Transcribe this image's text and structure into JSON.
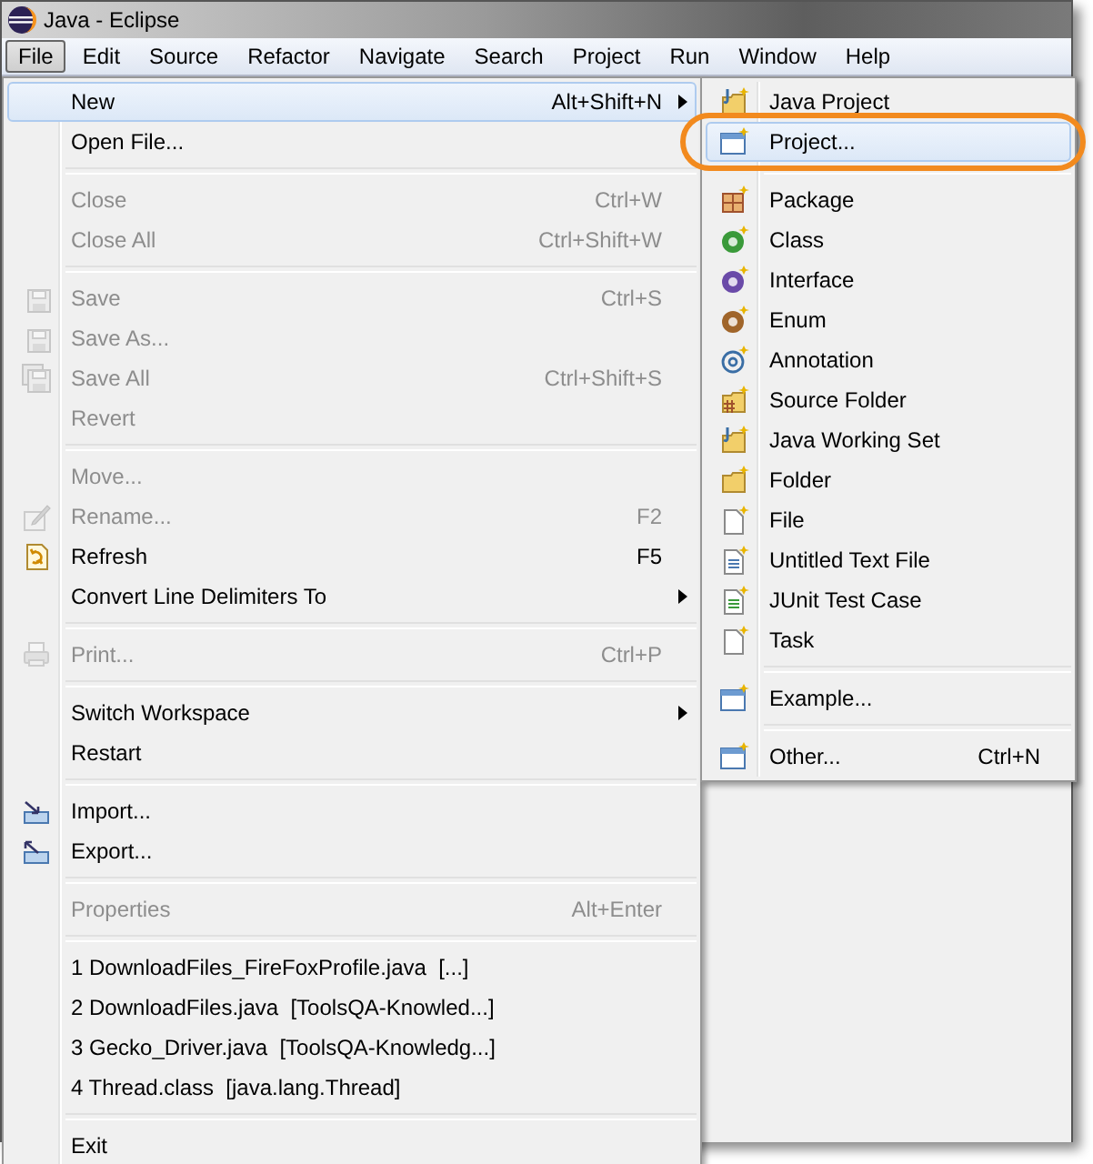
{
  "window": {
    "title": "Java - Eclipse"
  },
  "menu_bar": [
    {
      "label": "File",
      "selected": true
    },
    {
      "label": "Edit",
      "selected": false
    },
    {
      "label": "Source",
      "selected": false
    },
    {
      "label": "Refactor",
      "selected": false
    },
    {
      "label": "Navigate",
      "selected": false
    },
    {
      "label": "Search",
      "selected": false
    },
    {
      "label": "Project",
      "selected": false
    },
    {
      "label": "Run",
      "selected": false
    },
    {
      "label": "Window",
      "selected": false
    },
    {
      "label": "Help",
      "selected": false
    }
  ],
  "file_menu": [
    {
      "kind": "command",
      "label": "New",
      "shortcut": "Alt+Shift+N",
      "submenu": true,
      "disabled": false,
      "selected": true
    },
    {
      "kind": "command",
      "label": "Open File...",
      "submenu": false,
      "disabled": false,
      "selected": false
    },
    {
      "kind": "separator"
    },
    {
      "kind": "command",
      "label": "Close",
      "shortcut": "Ctrl+W",
      "submenu": false,
      "disabled": true,
      "selected": false
    },
    {
      "kind": "command",
      "label": "Close All",
      "shortcut": "Ctrl+Shift+W",
      "submenu": false,
      "disabled": true,
      "selected": false
    },
    {
      "kind": "separator"
    },
    {
      "kind": "command",
      "label": "Save",
      "shortcut": "Ctrl+S",
      "submenu": false,
      "disabled": true,
      "selected": false
    },
    {
      "kind": "command",
      "label": "Save As...",
      "submenu": false,
      "disabled": true,
      "selected": false
    },
    {
      "kind": "command",
      "label": "Save All",
      "shortcut": "Ctrl+Shift+S",
      "submenu": false,
      "disabled": true,
      "selected": false
    },
    {
      "kind": "command",
      "label": "Revert",
      "submenu": false,
      "disabled": true,
      "selected": false
    },
    {
      "kind": "separator"
    },
    {
      "kind": "command",
      "label": "Move...",
      "submenu": false,
      "disabled": true,
      "selected": false
    },
    {
      "kind": "command",
      "label": "Rename...",
      "shortcut": "F2",
      "submenu": false,
      "disabled": true,
      "selected": false
    },
    {
      "kind": "command",
      "label": "Refresh",
      "shortcut": "F5",
      "submenu": false,
      "disabled": false,
      "selected": false
    },
    {
      "kind": "command",
      "label": "Convert Line Delimiters To",
      "submenu": true,
      "disabled": false,
      "selected": false
    },
    {
      "kind": "separator"
    },
    {
      "kind": "command",
      "label": "Print...",
      "shortcut": "Ctrl+P",
      "submenu": false,
      "disabled": true,
      "selected": false
    },
    {
      "kind": "separator"
    },
    {
      "kind": "command",
      "label": "Switch Workspace",
      "submenu": true,
      "disabled": false,
      "selected": false
    },
    {
      "kind": "command",
      "label": "Restart",
      "submenu": false,
      "disabled": false,
      "selected": false
    },
    {
      "kind": "separator"
    },
    {
      "kind": "command",
      "label": "Import...",
      "submenu": false,
      "disabled": false,
      "selected": false
    },
    {
      "kind": "command",
      "label": "Export...",
      "submenu": false,
      "disabled": false,
      "selected": false
    },
    {
      "kind": "separator"
    },
    {
      "kind": "command",
      "label": "Properties",
      "shortcut": "Alt+Enter",
      "submenu": false,
      "disabled": true,
      "selected": false
    },
    {
      "kind": "separator"
    },
    {
      "kind": "command",
      "label": "1 DownloadFiles_FireFoxProfile.java  [...]",
      "submenu": false,
      "disabled": false,
      "selected": false
    },
    {
      "kind": "command",
      "label": "2 DownloadFiles.java  [ToolsQA-Knowled...]",
      "submenu": false,
      "disabled": false,
      "selected": false
    },
    {
      "kind": "command",
      "label": "3 Gecko_Driver.java  [ToolsQA-Knowledg...]",
      "submenu": false,
      "disabled": false,
      "selected": false
    },
    {
      "kind": "command",
      "label": "4 Thread.class  [java.lang.Thread]",
      "submenu": false,
      "disabled": false,
      "selected": false
    },
    {
      "kind": "separator"
    },
    {
      "kind": "command",
      "label": "Exit",
      "submenu": false,
      "disabled": false,
      "selected": false
    }
  ],
  "new_submenu": [
    {
      "kind": "command",
      "label": "Java Project",
      "selected": false,
      "circled": false
    },
    {
      "kind": "command",
      "label": "Project...",
      "selected": true,
      "circled": true
    },
    {
      "kind": "separator"
    },
    {
      "kind": "command",
      "label": "Package",
      "selected": false,
      "circled": false
    },
    {
      "kind": "command",
      "label": "Class",
      "selected": false,
      "circled": false
    },
    {
      "kind": "command",
      "label": "Interface",
      "selected": false,
      "circled": false
    },
    {
      "kind": "command",
      "label": "Enum",
      "selected": false,
      "circled": false
    },
    {
      "kind": "command",
      "label": "Annotation",
      "selected": false,
      "circled": false
    },
    {
      "kind": "command",
      "label": "Source Folder",
      "selected": false,
      "circled": false
    },
    {
      "kind": "command",
      "label": "Java Working Set",
      "selected": false,
      "circled": false
    },
    {
      "kind": "command",
      "label": "Folder",
      "selected": false,
      "circled": false
    },
    {
      "kind": "command",
      "label": "File",
      "selected": false,
      "circled": false
    },
    {
      "kind": "command",
      "label": "Untitled Text File",
      "selected": false,
      "circled": false
    },
    {
      "kind": "command",
      "label": "JUnit Test Case",
      "selected": false,
      "circled": false
    },
    {
      "kind": "command",
      "label": "Task",
      "selected": false,
      "circled": false
    },
    {
      "kind": "separator"
    },
    {
      "kind": "command",
      "label": "Example...",
      "selected": false,
      "circled": false
    },
    {
      "kind": "separator"
    },
    {
      "kind": "command",
      "label": "Other...",
      "shortcut": "Ctrl+N",
      "selected": false,
      "circled": false
    }
  ]
}
